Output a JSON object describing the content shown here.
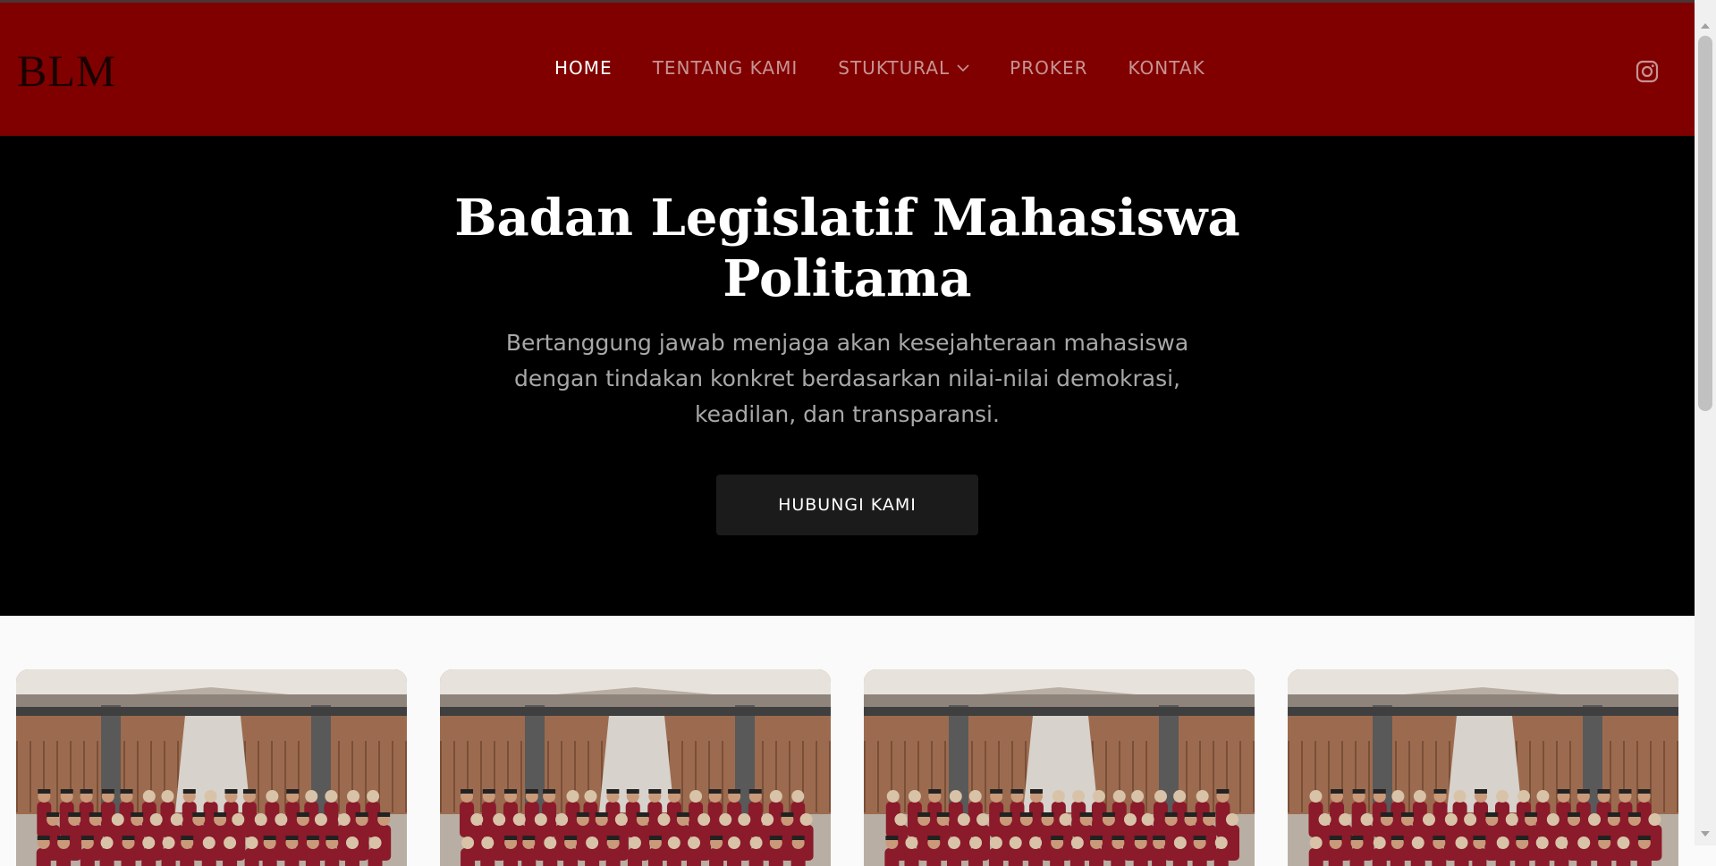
{
  "header": {
    "logo": "BLM",
    "nav": [
      {
        "label": "HOME",
        "active": true
      },
      {
        "label": "TENTANG KAMI"
      },
      {
        "label": "STUKTURAL",
        "has_dropdown": true
      },
      {
        "label": "PROKER"
      },
      {
        "label": "KONTAK"
      }
    ],
    "social_icon": "instagram-icon"
  },
  "hero": {
    "title_line1": "Badan Legislatif Mahasiswa",
    "title_line2": "Politama",
    "subtitle": "Bertanggung jawab menjaga akan kesejahteraan mahasiswa dengan tindakan konkret berdasarkan nilai-nilai demokrasi, keadilan, dan transparansi.",
    "cta_label": "HUBUNGI KAMI"
  },
  "gallery": {
    "photos": [
      "group-photo",
      "group-photo",
      "group-photo",
      "group-photo"
    ]
  },
  "colors": {
    "navbar_bg": "#800000",
    "hero_bg": "#000000",
    "nav_active": "#ffffff",
    "nav_inactive": "#c79393",
    "uniform": "#8b1a2a"
  }
}
